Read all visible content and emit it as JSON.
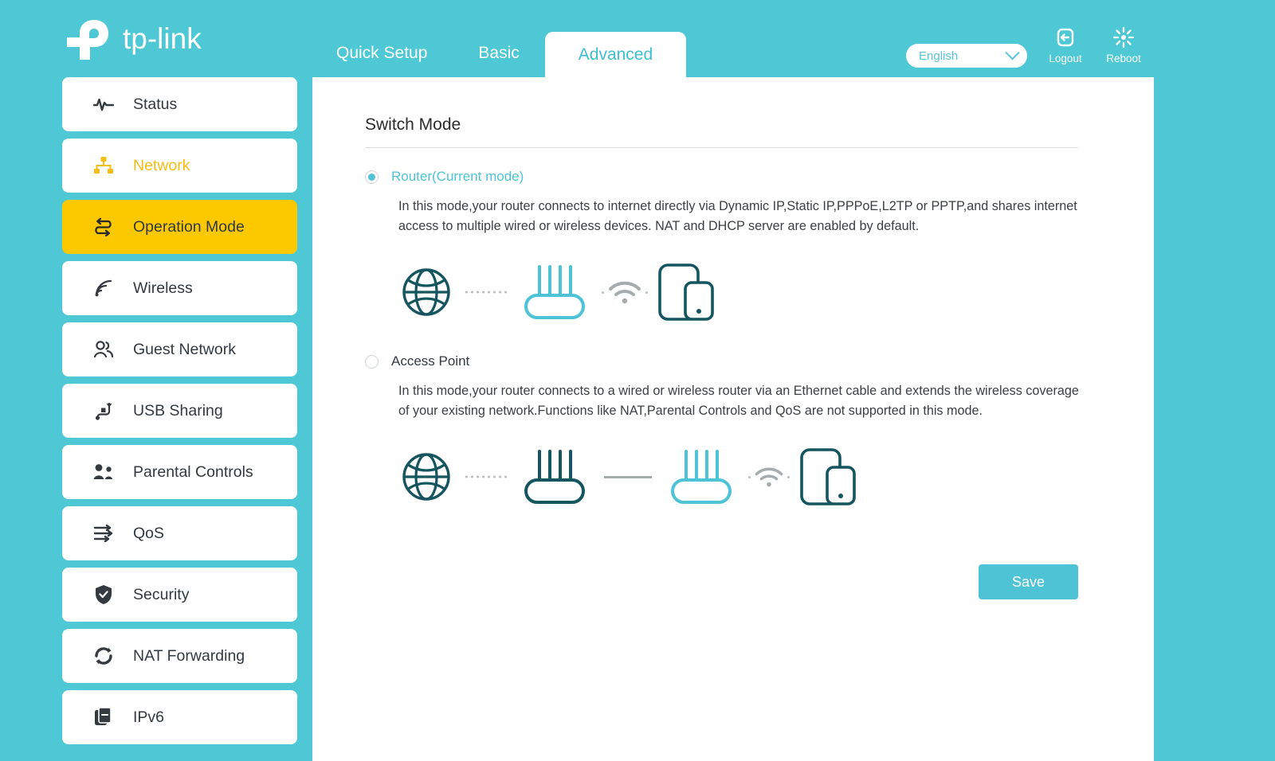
{
  "brand": {
    "name": "tp-link"
  },
  "header": {
    "tabs": [
      {
        "label": "Quick Setup",
        "active": false
      },
      {
        "label": "Basic",
        "active": false
      },
      {
        "label": "Advanced",
        "active": true
      }
    ],
    "language": {
      "value": "English"
    },
    "logout_label": "Logout",
    "reboot_label": "Reboot"
  },
  "sidebar": {
    "items": [
      {
        "label": "Status",
        "icon": "pulse-icon",
        "state": "normal"
      },
      {
        "label": "Network",
        "icon": "network-tree-icon",
        "state": "parent"
      },
      {
        "label": "Operation Mode",
        "icon": "swap-arrows-icon",
        "state": "active"
      },
      {
        "label": "Wireless",
        "icon": "wireless-signal-icon",
        "state": "normal"
      },
      {
        "label": "Guest Network",
        "icon": "people-icon",
        "state": "normal"
      },
      {
        "label": "USB Sharing",
        "icon": "usb-icon",
        "state": "normal"
      },
      {
        "label": "Parental Controls",
        "icon": "parent-child-icon",
        "state": "normal"
      },
      {
        "label": "QoS",
        "icon": "sliders-arrows-icon",
        "state": "normal"
      },
      {
        "label": "Security",
        "icon": "shield-check-icon",
        "state": "normal"
      },
      {
        "label": "NAT Forwarding",
        "icon": "refresh-circle-icon",
        "state": "normal"
      },
      {
        "label": "IPv6",
        "icon": "document-icon",
        "state": "normal"
      }
    ]
  },
  "main": {
    "title": "Switch Mode",
    "modes": [
      {
        "label": "Router(Current mode)",
        "selected": true,
        "description": "In this mode,your router connects to internet directly via Dynamic IP,Static IP,PPPoE,L2TP or PPTP,and shares internet access to multiple wired or wireless devices. NAT and DHCP server are enabled by default."
      },
      {
        "label": "Access Point",
        "selected": false,
        "description": "In this mode,your router connects to a wired or wireless router via an Ethernet cable and extends the wireless coverage of your existing network.Functions like NAT,Parental Controls and QoS are not supported in this mode."
      }
    ],
    "save_label": "Save"
  },
  "colors": {
    "teal": "#4ec8d4",
    "accent": "#4ec3d6",
    "highlight_yellow": "#fcc800",
    "parent_orange": "#f6bd16",
    "icon_dark": "#14555f",
    "icon_light": "#4ec3d6"
  }
}
